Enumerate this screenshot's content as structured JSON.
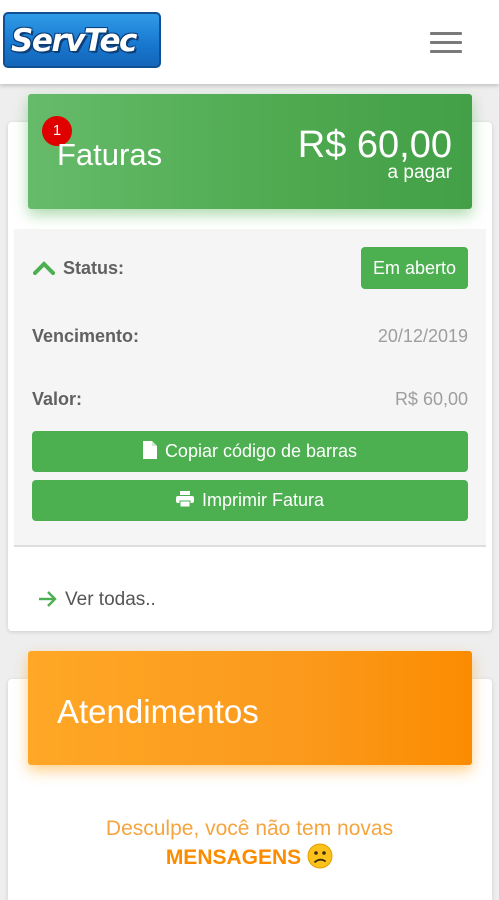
{
  "app": {
    "logo_text": "ServTec"
  },
  "menu": {
    "icon": "hamburger-menu-icon"
  },
  "faturas": {
    "badge_count": "1",
    "title": "Faturas",
    "amount": "R$ 60,00",
    "amount_sub": "a pagar",
    "color": "#4caf50",
    "status_label": "Status:",
    "status_value": "Em aberto",
    "vencimento_label": "Vencimento:",
    "vencimento_value": "20/12/2019",
    "valor_label": "Valor:",
    "valor_value": "R$ 60,00",
    "copy_button": "Copiar código de barras",
    "print_button": "Imprimir Fatura",
    "ver_todas": "Ver todas.."
  },
  "atendimentos": {
    "title": "Atendimentos",
    "color": "#fb8c00",
    "message_line1": "Desculpe, você não tem novas",
    "message_line2": "MENSAGENS"
  }
}
